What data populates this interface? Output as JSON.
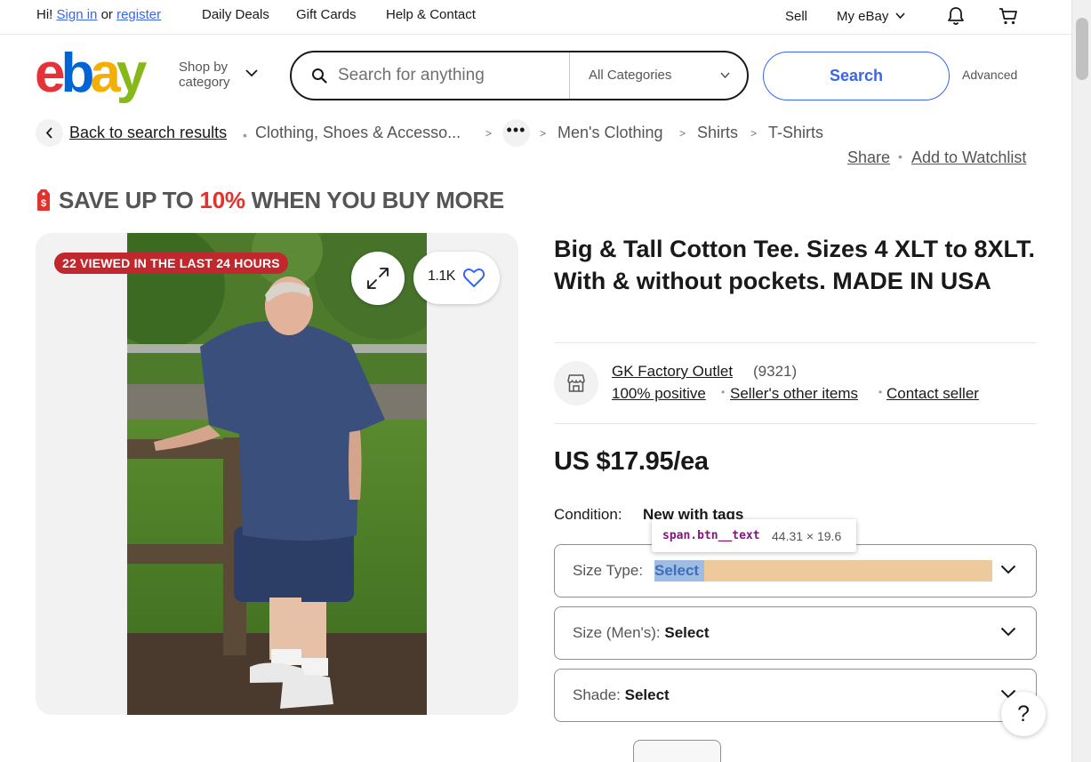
{
  "topbar": {
    "greeting": "Hi!",
    "sign_in": "Sign in",
    "or": "or",
    "register": "register",
    "links": [
      "Daily Deals",
      "Gift Cards",
      "Help & Contact"
    ],
    "sell": "Sell",
    "my_ebay": "My eBay"
  },
  "header": {
    "logo_text": "ebay",
    "shop_by_line1": "Shop by",
    "shop_by_line2": "category",
    "search_placeholder": "Search for anything",
    "category": "All Categories",
    "search_button": "Search",
    "advanced": "Advanced"
  },
  "breadcrumb": {
    "back": "Back to search results",
    "items": [
      "Clothing, Shoes & Accesso...",
      "Men's Clothing",
      "Shirts",
      "T-Shirts"
    ],
    "more": "•••",
    "share": "Share",
    "watchlist": "Add to Watchlist"
  },
  "promo": {
    "prefix": "SAVE UP TO ",
    "percent": "10%",
    "suffix": " WHEN YOU BUY MORE"
  },
  "image_panel": {
    "viewed_badge": "22 VIEWED IN THE LAST 24 HOURS",
    "watch_count": "1.1K"
  },
  "product": {
    "title": "Big & Tall Cotton Tee. Sizes 4 XLT to 8XLT. With & without pockets. MADE IN USA",
    "price": "US $17.95/ea",
    "condition_label": "Condition:",
    "condition_value": "New with tags"
  },
  "seller": {
    "name": "GK Factory Outlet",
    "count": "(9321)",
    "positive": "100% positive",
    "other_items": "Seller's other items",
    "contact": "Contact seller"
  },
  "selects": [
    {
      "label": "Size Type: ",
      "value": "Select"
    },
    {
      "label": "Size (Men's): ",
      "value": "Select"
    },
    {
      "label": "Shade: ",
      "value": "Select"
    }
  ],
  "devtools_tooltip": {
    "selector": "span.btn__text",
    "dimensions": "44.31 × 19.6"
  },
  "help": "?",
  "colors": {
    "accent_blue": "#3665f3",
    "promo_red": "#e0332b",
    "badge_red": "#c0282d",
    "logo_red": "#e53238",
    "logo_blue": "#0064d2",
    "logo_yellow": "#f5af02",
    "logo_green": "#86b817"
  }
}
